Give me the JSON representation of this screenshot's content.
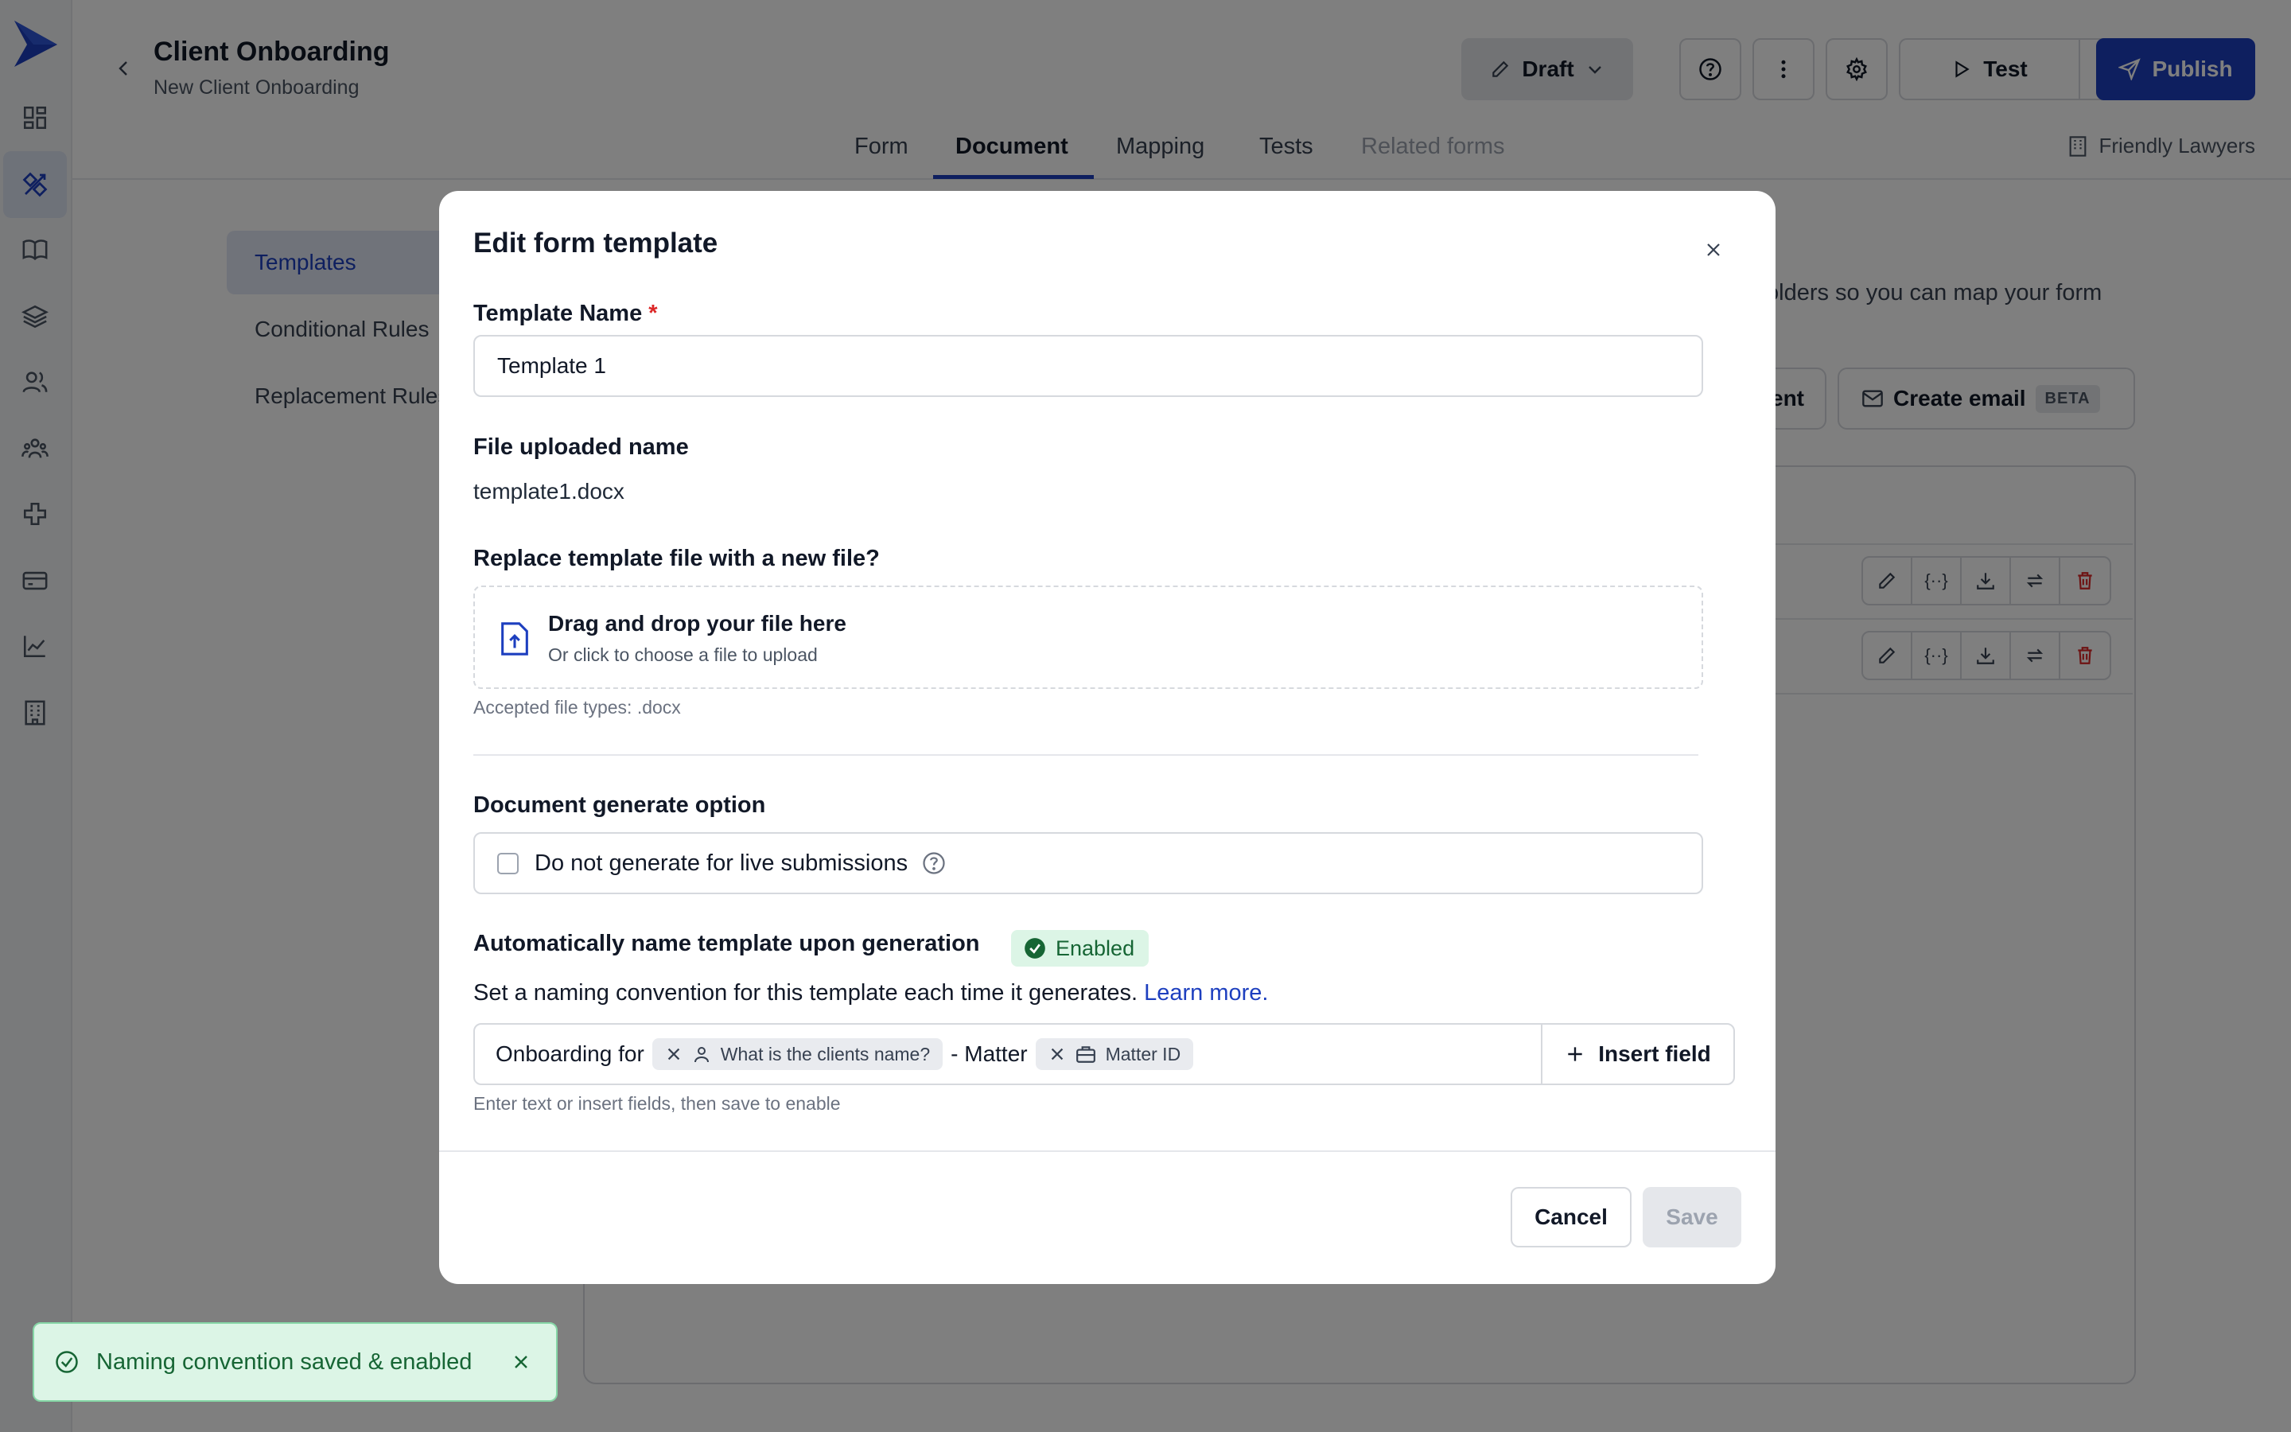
{
  "app": {
    "title": "Client Onboarding",
    "subtitle": "New Client Onboarding",
    "accent_color": "#1d3fbf"
  },
  "header": {
    "status_button_label": "Draft",
    "test_button_label": "Test",
    "publish_button_label": "Publish",
    "organization": "Friendly Lawyers"
  },
  "tabs": [
    {
      "label": "Form"
    },
    {
      "label": "Document"
    },
    {
      "label": "Mapping"
    },
    {
      "label": "Tests"
    },
    {
      "label": "Related forms"
    }
  ],
  "sidebar": {
    "items": [
      {
        "label": "Templates"
      },
      {
        "label": "Conditional Rules"
      },
      {
        "label": "Replacement Rules"
      }
    ]
  },
  "background": {
    "description_fragment": "olders so you can map your form",
    "add_document_fragment": "ent",
    "create_email_label": "Create email",
    "beta_badge": "BETA"
  },
  "modal": {
    "title": "Edit form template",
    "template_name_label": "Template Name",
    "required_marker": "*",
    "template_name_value": "Template 1",
    "file_uploaded_label": "File uploaded name",
    "file_uploaded_value": "template1.docx",
    "replace_label": "Replace template file with a new file?",
    "drop_title": "Drag and drop your file here",
    "drop_subtitle": "Or click to choose a file to upload",
    "accepted_types": "Accepted file types: .docx",
    "generate_option_label": "Document generate option",
    "checkbox_label": "Do not generate for live submissions",
    "checkbox_checked": false,
    "auto_name_label": "Automatically name template upon generation",
    "enabled_badge": "Enabled",
    "naming_description": "Set a naming convention for this template each time it generates.",
    "learn_more": "Learn more.",
    "naming": {
      "text1": "Onboarding for",
      "chip1": "What is the clients name?",
      "text2": "- Matter",
      "chip2": "Matter ID"
    },
    "insert_field_label": "Insert field",
    "naming_hint": "Enter text or insert fields, then save to enable",
    "cancel_label": "Cancel",
    "save_label": "Save"
  },
  "toast": {
    "message": "Naming convention saved & enabled",
    "color": "#166534"
  }
}
